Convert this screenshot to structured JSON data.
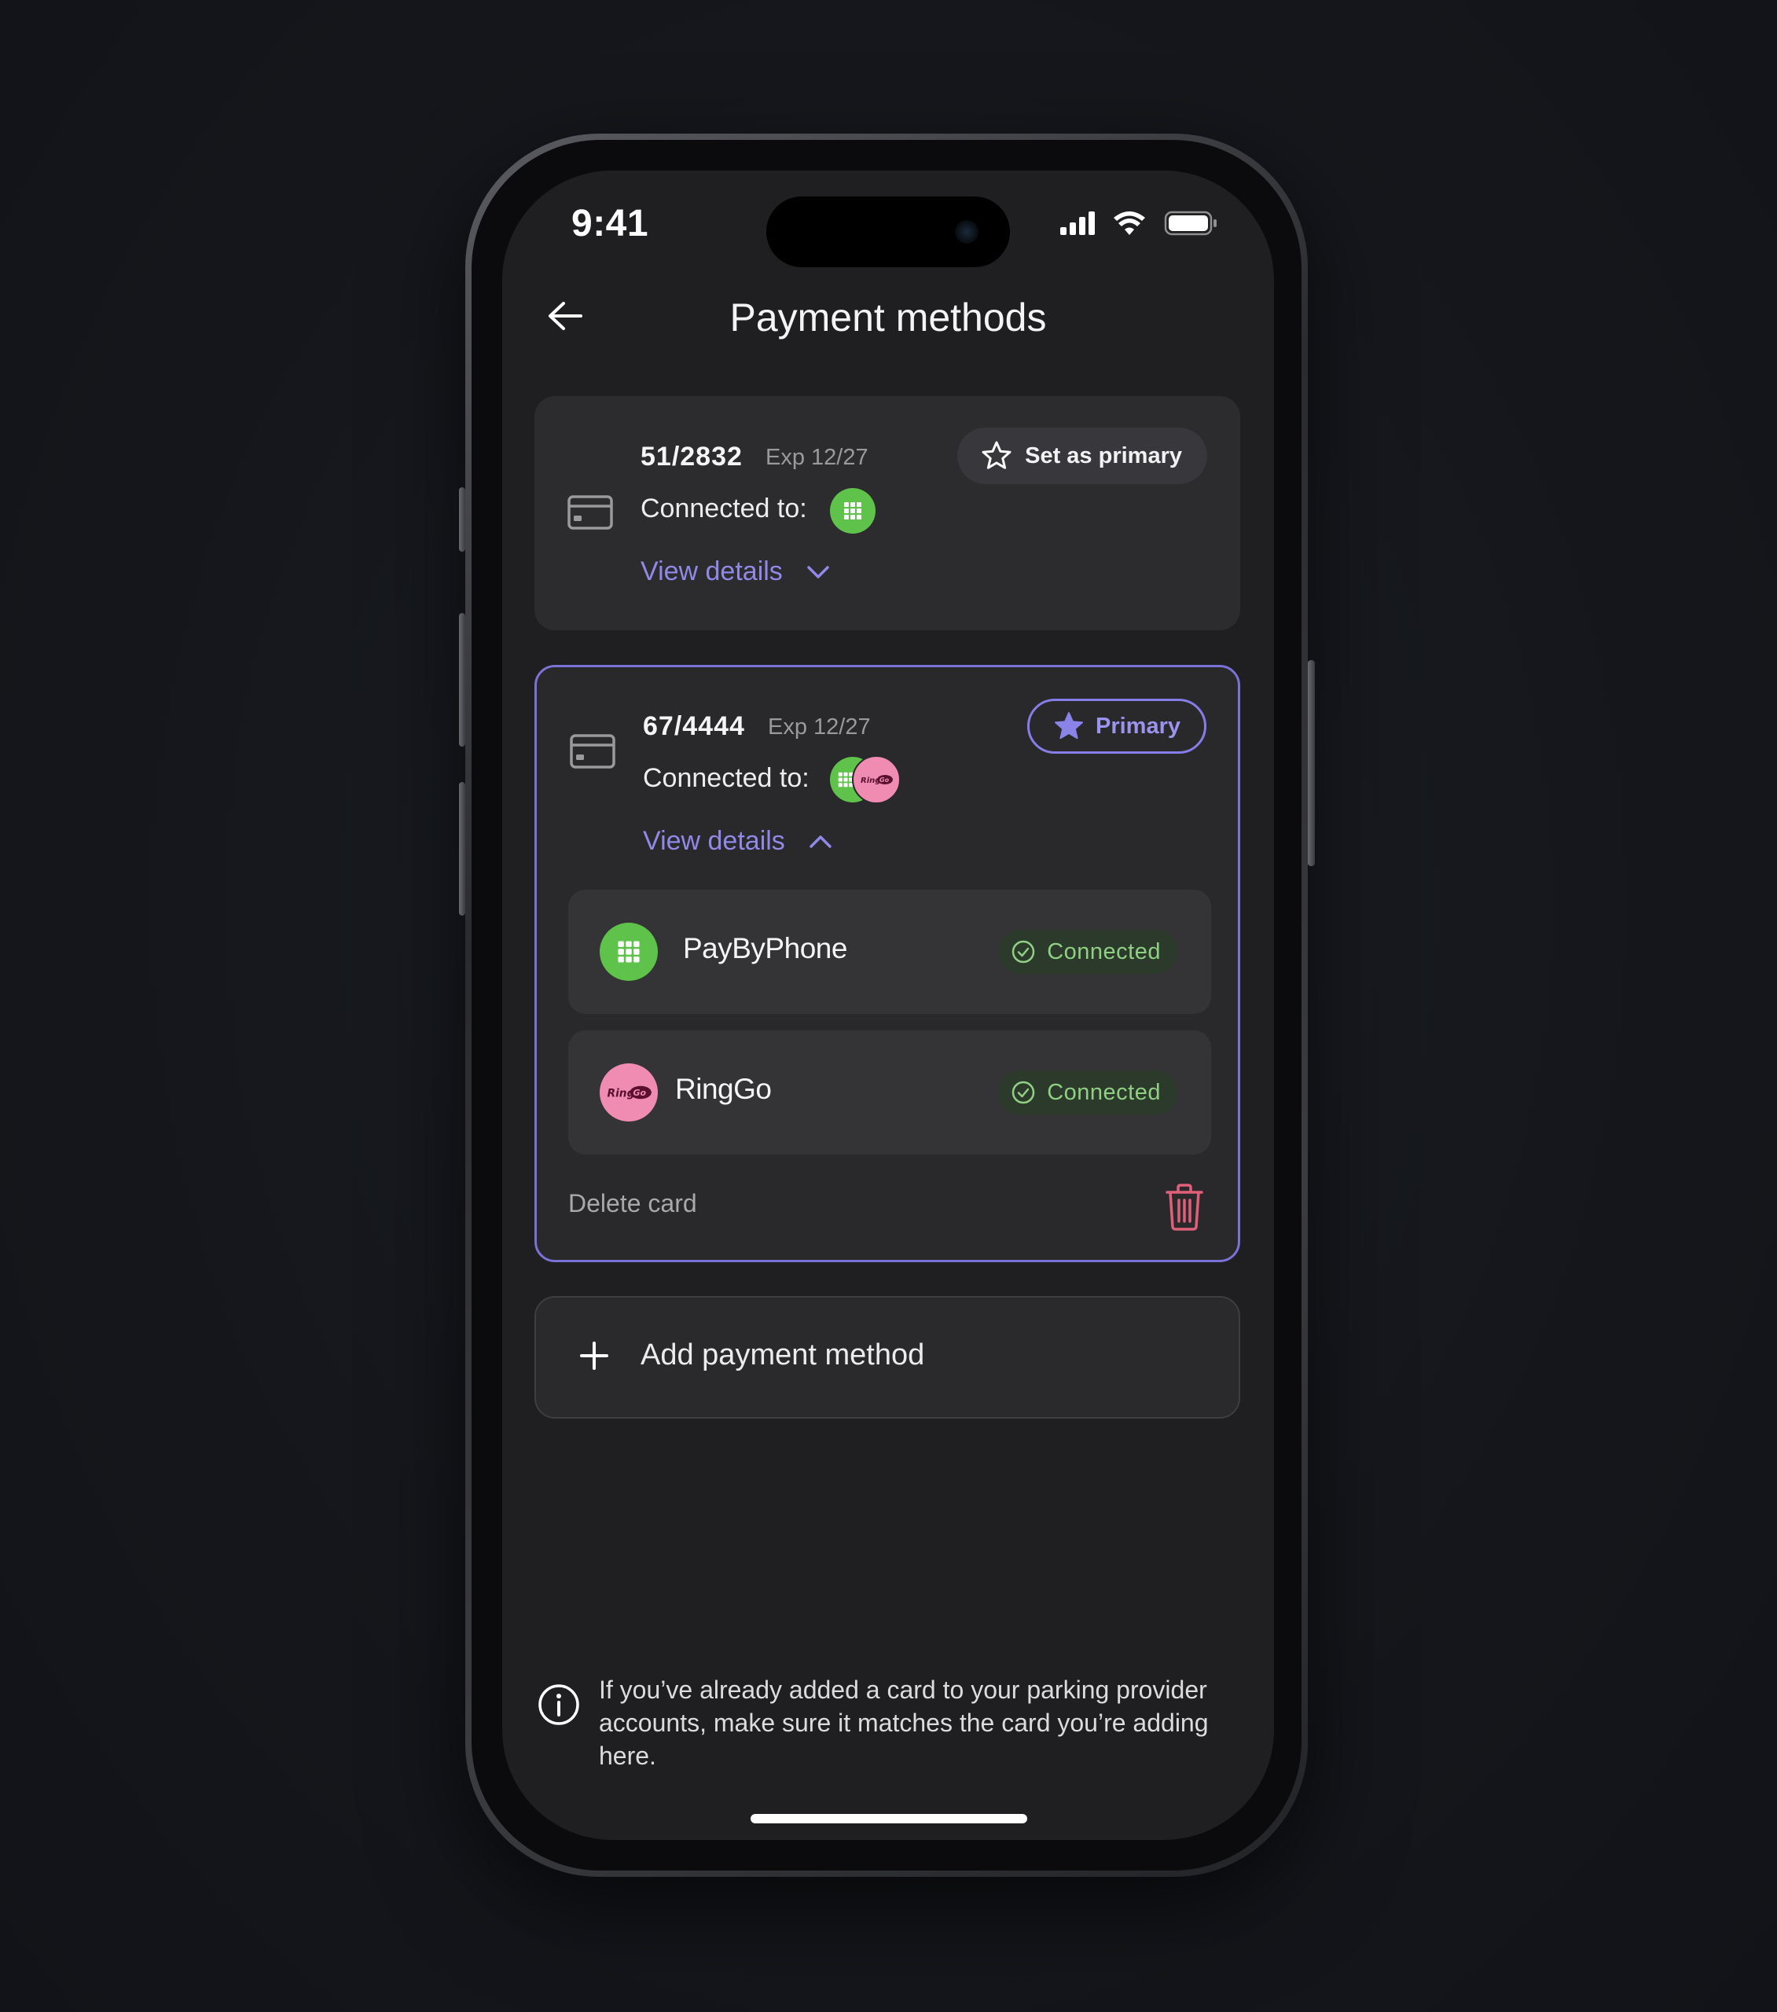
{
  "status_bar": {
    "time": "9:41"
  },
  "header": {
    "title": "Payment methods",
    "back_icon": "arrow-left-icon"
  },
  "cards": [
    {
      "number": "51/2832",
      "expiry": "Exp 12/27",
      "connected_label": "Connected to:",
      "connected_providers": [
        "PayByPhone"
      ],
      "action_label": "Set as primary",
      "view_details_label": "View details",
      "expanded": false,
      "primary": false
    },
    {
      "number": "67/4444",
      "expiry": "Exp 12/27",
      "connected_label": "Connected to:",
      "connected_providers": [
        "PayByPhone",
        "RingGo"
      ],
      "action_label": "Primary",
      "view_details_label": "View details",
      "expanded": true,
      "primary": true,
      "providers": [
        {
          "name": "PayByPhone",
          "status": "Connected"
        },
        {
          "name": "RingGo",
          "status": "Connected"
        }
      ],
      "delete_label": "Delete card"
    }
  ],
  "add_payment": {
    "label": "Add payment method"
  },
  "info": {
    "text": "If you’ve already added a card to your parking provider accounts, make sure it matches the card you’re adding here."
  },
  "colors": {
    "accent": "#8a83e8",
    "paybyphone_green": "#5fc24a",
    "ringgo_pink": "#f08bb1",
    "connected_green": "#8fd082",
    "delete_red": "#e0607a"
  }
}
